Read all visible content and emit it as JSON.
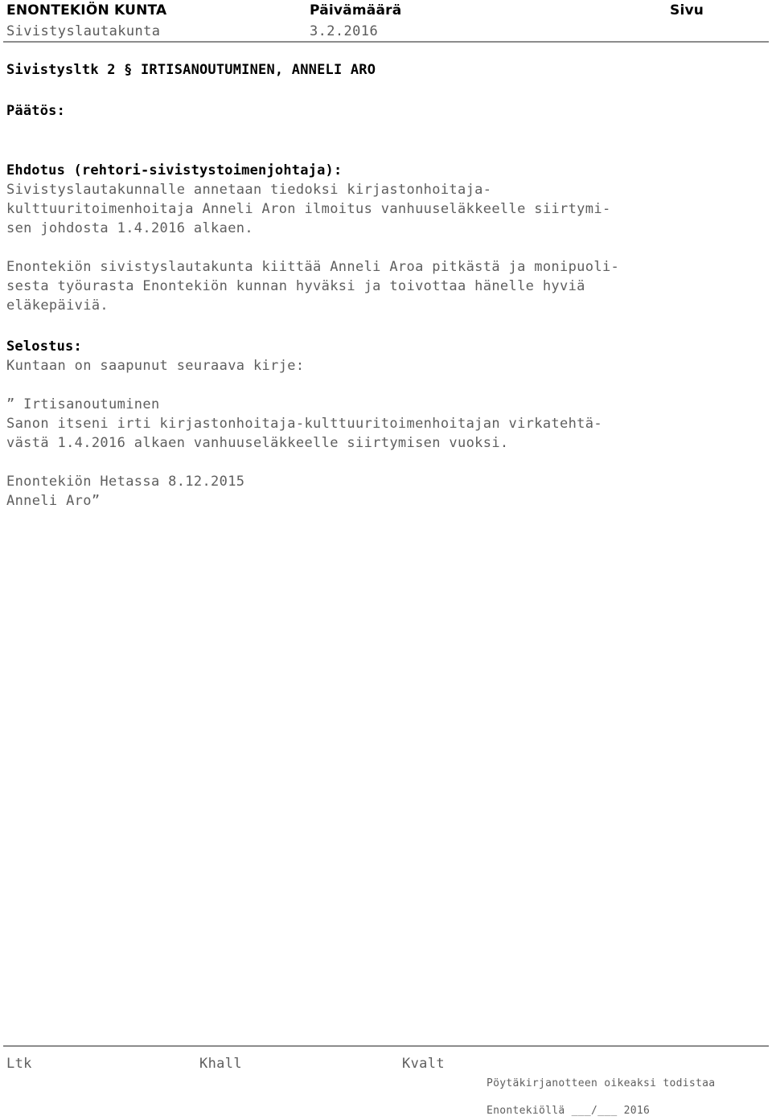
{
  "header": {
    "columns": {
      "organization_label": "ENONTEKIÖN KUNTA",
      "date_label": "Päivämäärä",
      "page_label": "Sivu"
    },
    "values": {
      "board_name": "Sivistyslautakunta",
      "date_value": "3.2.2016",
      "page_value": ""
    }
  },
  "document": {
    "title": "Sivistysltk 2 § IRTISANOUTUMINEN, ANNELI ARO",
    "decision_heading": "Päätös:",
    "proposal_heading": "Ehdotus (rehtori-sivistystoimenjohtaja):",
    "proposal_lines": [
      "Sivistyslautakunnalle annetaan tiedoksi kirjastonhoitaja-",
      "kulttuuritoimenhoitaja Anneli Aron ilmoitus vanhuuseläkkeelle siirtymi-",
      "sen johdosta 1.4.2016 alkaen."
    ],
    "thanks_lines": [
      "Enontekiön sivistyslautakunta kiittää Anneli Aroa pitkästä ja monipuoli-",
      "sesta työurasta Enontekiön kunnan hyväksi ja toivottaa hänelle hyviä",
      "eläkepäiviä."
    ],
    "account_heading": "Selostus:",
    "account_intro": "Kuntaan on saapunut seuraava kirje:",
    "letter_lines": [
      "” Irtisanoutuminen",
      "Sanon itseni irti kirjastonhoitaja-kulttuuritoimenhoitajan virkatehtä-",
      "västä 1.4.2016 alkaen vanhuuseläkkeelle siirtymisen vuoksi."
    ],
    "letter_signature": [
      "Enontekiön Hetassa 8.12.2015",
      "Anneli Aro”"
    ]
  },
  "footer": {
    "signature_columns": [
      "Ltk",
      "Khall",
      "Kvalt"
    ],
    "certification": "Pöytäkirjanotteen oikeaksi todistaa",
    "place_and_date": "Enontekiöllä ___/___ 2016"
  },
  "colors": {
    "body_text": "#5e5e5e",
    "heading_text": "#000000",
    "rule": "#8c8c8c",
    "page_background": "#ffffff"
  }
}
